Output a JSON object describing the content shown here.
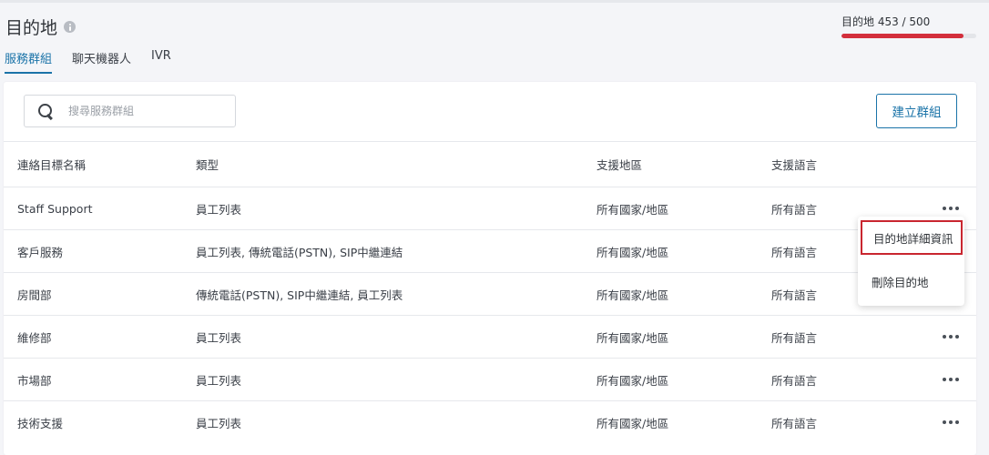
{
  "header": {
    "title": "目的地",
    "quota_text": "目的地 453 / 500",
    "quota_progress": 0.906,
    "quota_color": "#d32f3c"
  },
  "tabs": [
    {
      "label": "服務群組",
      "active": true
    },
    {
      "label": "聊天機器人",
      "active": false
    },
    {
      "label": "IVR",
      "active": false
    }
  ],
  "toolbar": {
    "search_placeholder": "搜尋服務群組",
    "search_value": "",
    "create_label": "建立群組"
  },
  "table": {
    "columns": [
      "連絡目標名稱",
      "類型",
      "支援地區",
      "支援語言"
    ],
    "rows": [
      {
        "name": "Staff Support",
        "type": "員工列表",
        "region": "所有國家/地區",
        "language": "所有語言"
      },
      {
        "name": "客戶服務",
        "type": "員工列表, 傳統電話(PSTN), SIP中繼連結",
        "region": "所有國家/地區",
        "language": "所有語言"
      },
      {
        "name": "房間部",
        "type": "傳統電話(PSTN), SIP中繼連結, 員工列表",
        "region": "所有國家/地區",
        "language": "所有語言"
      },
      {
        "name": "維修部",
        "type": "員工列表",
        "region": "所有國家/地區",
        "language": "所有語言"
      },
      {
        "name": "市場部",
        "type": "員工列表",
        "region": "所有國家/地區",
        "language": "所有語言"
      },
      {
        "name": "技術支援",
        "type": "員工列表",
        "region": "所有國家/地區",
        "language": "所有語言"
      }
    ]
  },
  "context_menu": {
    "items": [
      "目的地詳細資訊",
      "刪除目的地"
    ]
  },
  "colors": {
    "accent": "#1a73a8",
    "highlight_border": "#c9262f"
  }
}
